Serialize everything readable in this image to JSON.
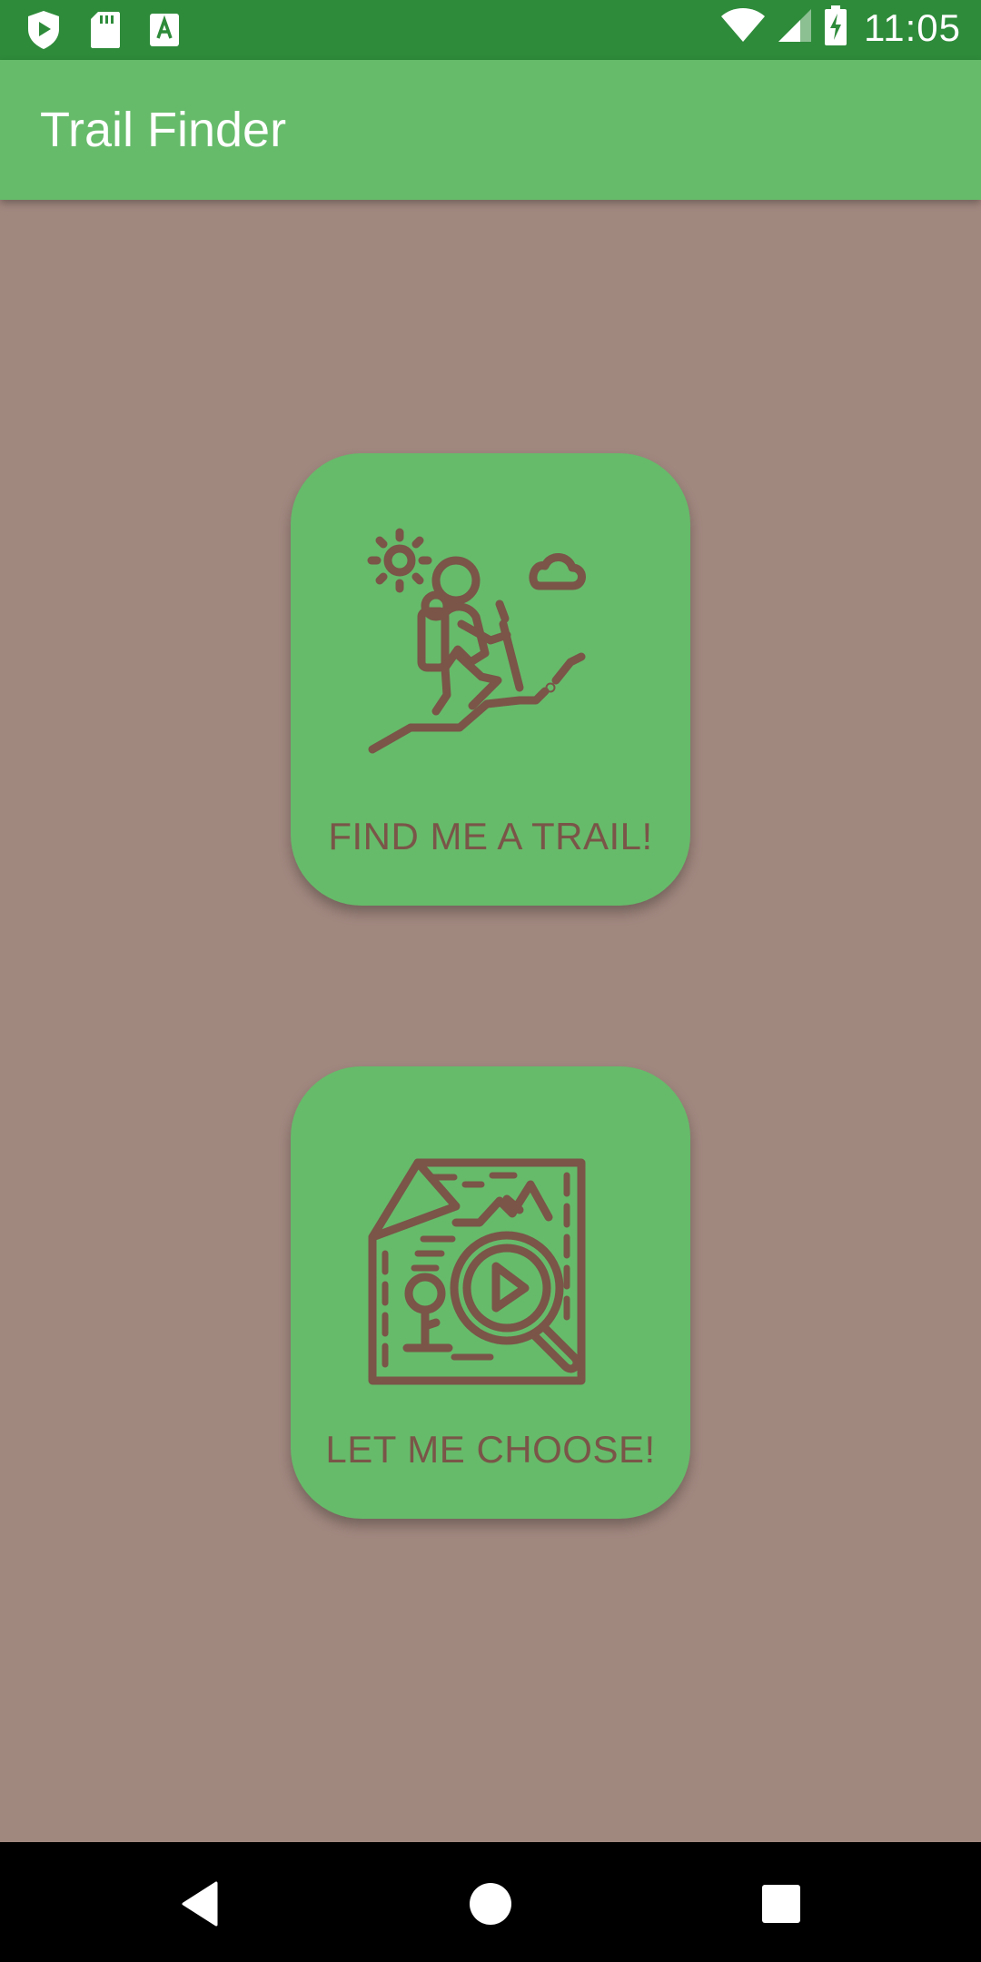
{
  "status_bar": {
    "time": "11:05",
    "icons": [
      "shield-play-icon",
      "sd-card-icon",
      "text-a-icon",
      "wifi-icon",
      "cell-signal-icon",
      "battery-charging-icon"
    ]
  },
  "app_bar": {
    "title": "Trail Finder"
  },
  "cards": [
    {
      "label": "FIND ME A TRAIL!",
      "icon": "hiker-icon"
    },
    {
      "label": "LET ME CHOOSE!",
      "icon": "map-search-icon"
    }
  ],
  "nav_bar": {
    "icons": [
      "back-icon",
      "home-icon",
      "recents-icon"
    ]
  },
  "colors": {
    "status_bar": "#2e8b3a",
    "app_bar": "#66bb6a",
    "background": "#a1887f",
    "card": "#66bb6a",
    "card_text": "#7a5548"
  }
}
